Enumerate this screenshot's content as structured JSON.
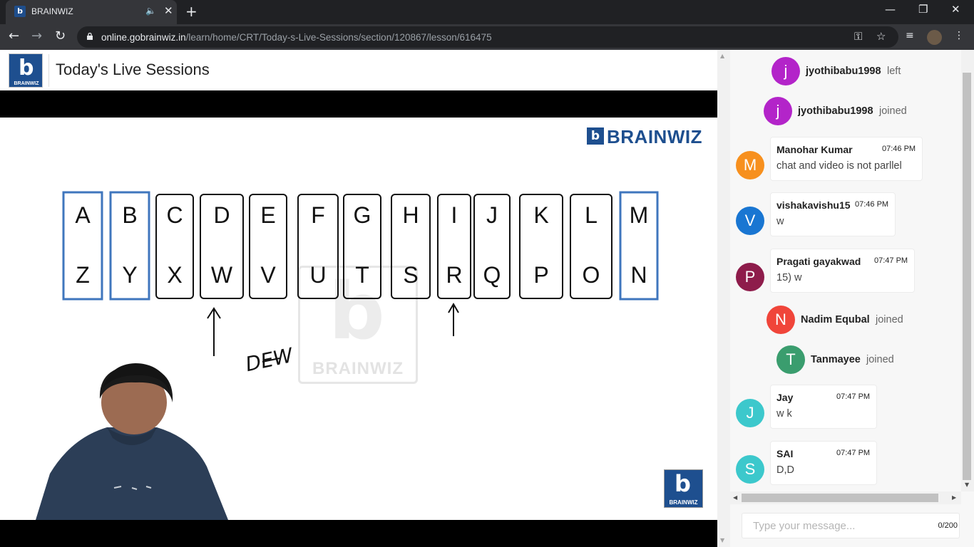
{
  "browser": {
    "tab_title": "BRAINWIZ",
    "tab_favicon": "b",
    "url_host": "online.gobrainwiz.in",
    "url_path": "/learn/home/CRT/Today-s-Live-Sessions/section/120867/lesson/616475",
    "icons": [
      "back-arrow-icon",
      "forward-arrow-icon",
      "reload-icon",
      "lock-icon",
      "key-icon",
      "star-icon",
      "playlist-icon",
      "profile-avatar",
      "more-vert-icon"
    ]
  },
  "header": {
    "logo_letter": "b",
    "logo_text": "BRAINWIZ",
    "title": "Today's Live Sessions"
  },
  "board": {
    "brand_text": "BRAINWIZ",
    "brand_letter": "b",
    "top_row": [
      "A",
      "B",
      "C",
      "D",
      "E",
      "F",
      "G",
      "H",
      "I",
      "J",
      "K",
      "L",
      "M"
    ],
    "bottom_row": [
      "Z",
      "Y",
      "X",
      "W",
      "V",
      "U",
      "T",
      "S",
      "R",
      "Q",
      "P",
      "O",
      "N"
    ],
    "handwriting": "DEW",
    "watermark_text": "BRAINWIZ",
    "corner_logo_text": "BRAINWIZ",
    "blue_box_color": "#3f76bd"
  },
  "chat": {
    "events": [
      {
        "type": "system",
        "initial": "j",
        "name": "jyothibabu1998",
        "status": "left",
        "color": "#b324c9"
      },
      {
        "type": "system",
        "initial": "j",
        "name": "jyothibabu1998",
        "status": "joined",
        "color": "#b324c9"
      },
      {
        "type": "message",
        "initial": "M",
        "name": "Manohar Kumar",
        "time": "07:46 PM",
        "text": "chat and video is not parllel",
        "color": "#f7901e"
      },
      {
        "type": "message",
        "initial": "V",
        "name": "vishakavishu15",
        "time": "07:46 PM",
        "text": "w",
        "color": "#1976d2"
      },
      {
        "type": "message",
        "initial": "P",
        "name": "Pragati gayakwad",
        "time": "07:47 PM",
        "text": "15) w",
        "color": "#8e1c4b"
      },
      {
        "type": "system",
        "initial": "N",
        "name": "Nadim Equbal",
        "status": "joined",
        "color": "#f0453a"
      },
      {
        "type": "system",
        "initial": "T",
        "name": "Tanmayee",
        "status": "joined",
        "color": "#3a9d6e"
      },
      {
        "type": "message",
        "initial": "J",
        "name": "Jay",
        "time": "07:47 PM",
        "text": "w k",
        "color": "#3cc8cc"
      },
      {
        "type": "message",
        "initial": "S",
        "name": "SAI",
        "time": "07:47 PM",
        "text": "D,D",
        "color": "#3cc8cc"
      }
    ],
    "input_placeholder": "Type your message...",
    "char_count": "0/200"
  }
}
